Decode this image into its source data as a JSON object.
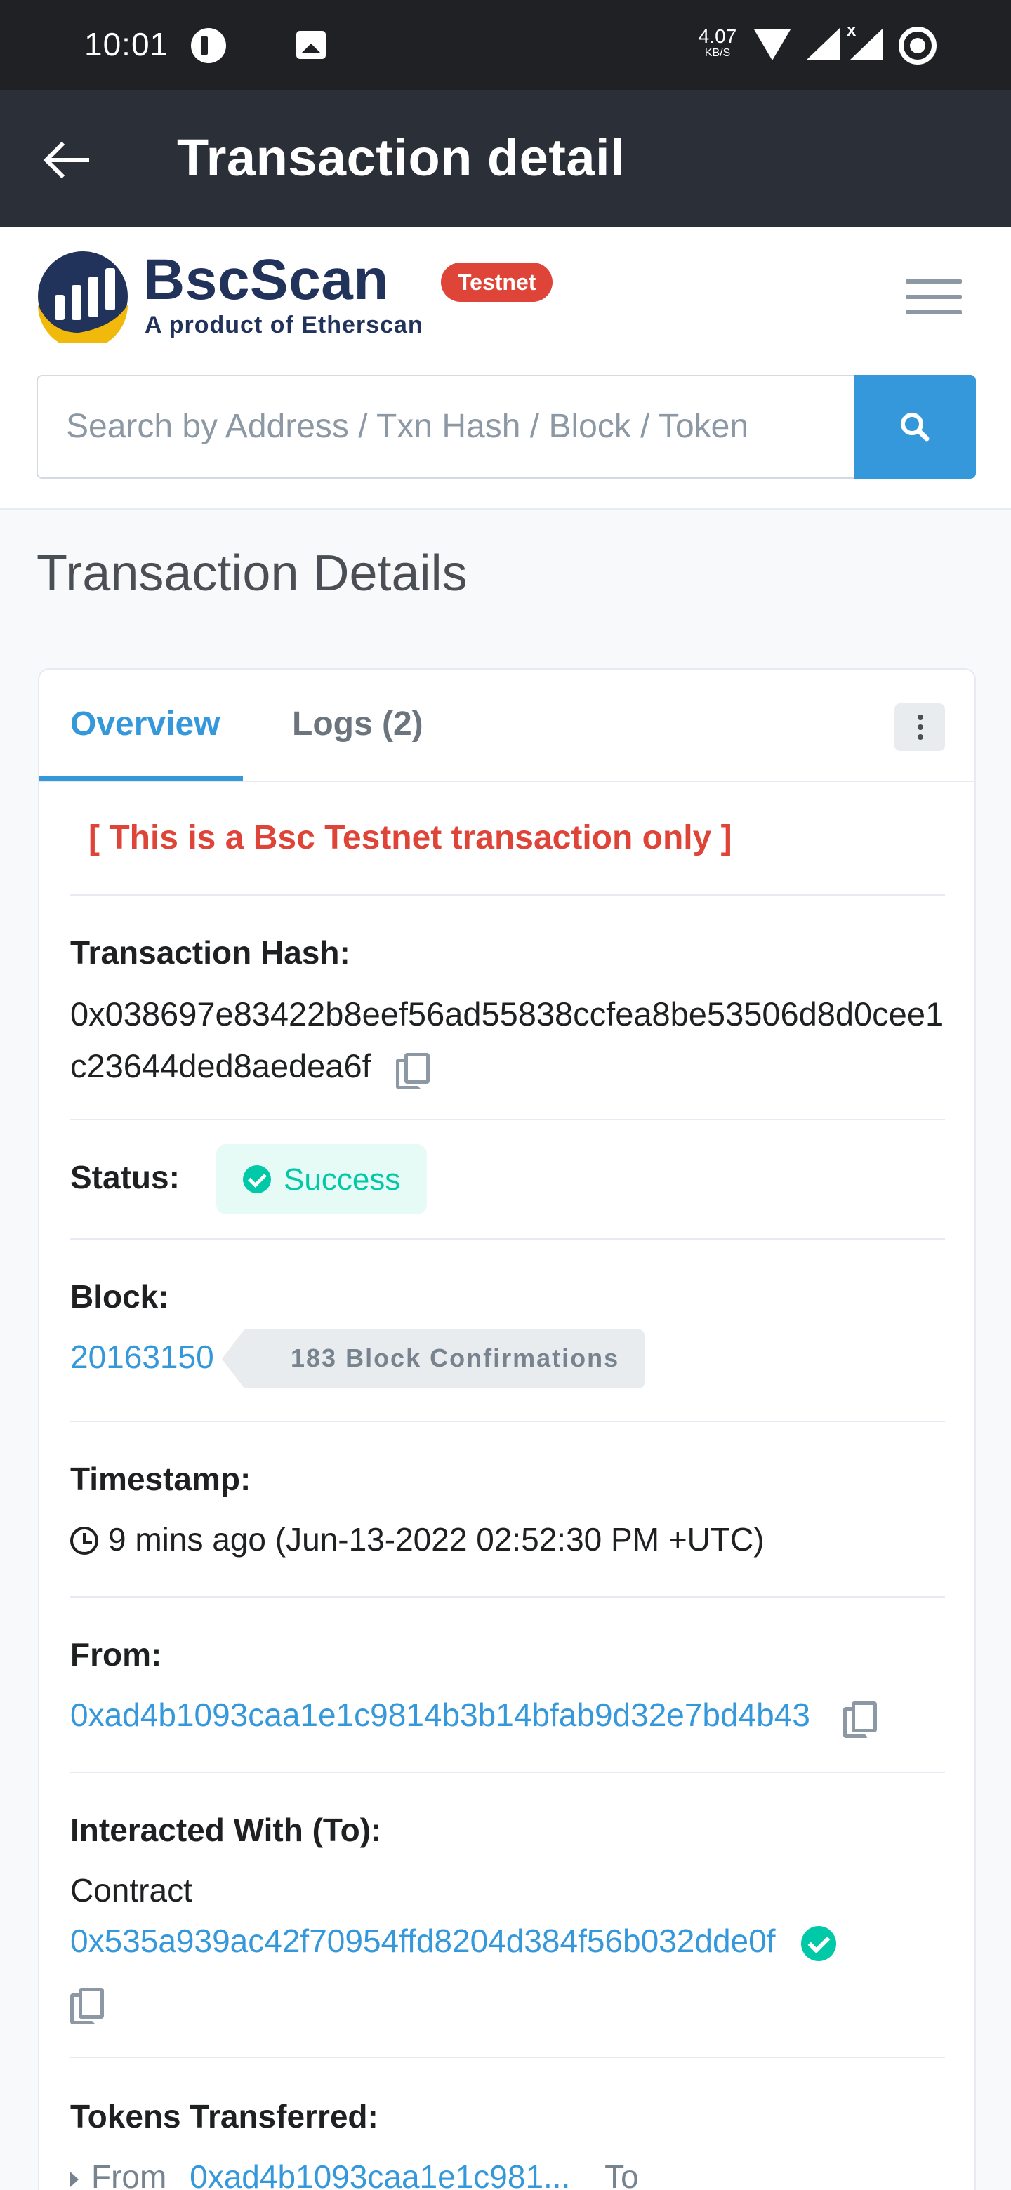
{
  "status_bar": {
    "time": "10:01",
    "speed_value": "4.07",
    "speed_unit": "KB/S",
    "icons": [
      "pinned-app-icon",
      "image-notification-icon",
      "wifi-icon",
      "signal-icon",
      "signal-x-icon",
      "ring-icon"
    ],
    "signal_flag": "x"
  },
  "app_bar": {
    "title": "Transaction detail",
    "back_icon": "back-arrow-icon"
  },
  "header": {
    "brand_name": "BscScan",
    "brand_subtitle": "A product of Etherscan",
    "network_badge": "Testnet",
    "menu_icon": "hamburger-menu-icon",
    "search_placeholder": "Search by Address / Txn Hash / Block / Token",
    "search_icon": "search-icon"
  },
  "page_title": "Transaction Details",
  "tabs": [
    {
      "label": "Overview",
      "active": true
    },
    {
      "label": "Logs (2)",
      "active": false
    }
  ],
  "notice": "[ This is a Bsc Testnet transaction only ]",
  "details": {
    "hash_label": "Transaction Hash:",
    "hash_value": "0x038697e83422b8eef56ad55838ccfea8be53506d8d0cee1c23644ded8aedea6f",
    "status_label": "Status:",
    "status_value": "Success",
    "block_label": "Block:",
    "block_value": "20163150",
    "block_confirmations": "183 Block Confirmations",
    "timestamp_label": "Timestamp:",
    "timestamp_value": "9 mins ago (Jun-13-2022 02:52:30 PM +UTC)",
    "from_label": "From:",
    "from_value": "0xad4b1093caa1e1c9814b3b14bfab9d32e7bd4b43",
    "to_label": "Interacted With (To):",
    "to_type": "Contract",
    "to_value": "0x535a939ac42f70954ffd8204d384f56b032dde0f",
    "tokens_label": "Tokens Transferred:",
    "token_from_label": "From",
    "token_from_value": "0xad4b1093caa1e1c981...",
    "token_to_label": "To"
  },
  "colors": {
    "accent": "#3498db",
    "success": "#00c9a7",
    "danger": "#de4437",
    "appbar": "#2b2f38",
    "statusbar": "#202125"
  }
}
